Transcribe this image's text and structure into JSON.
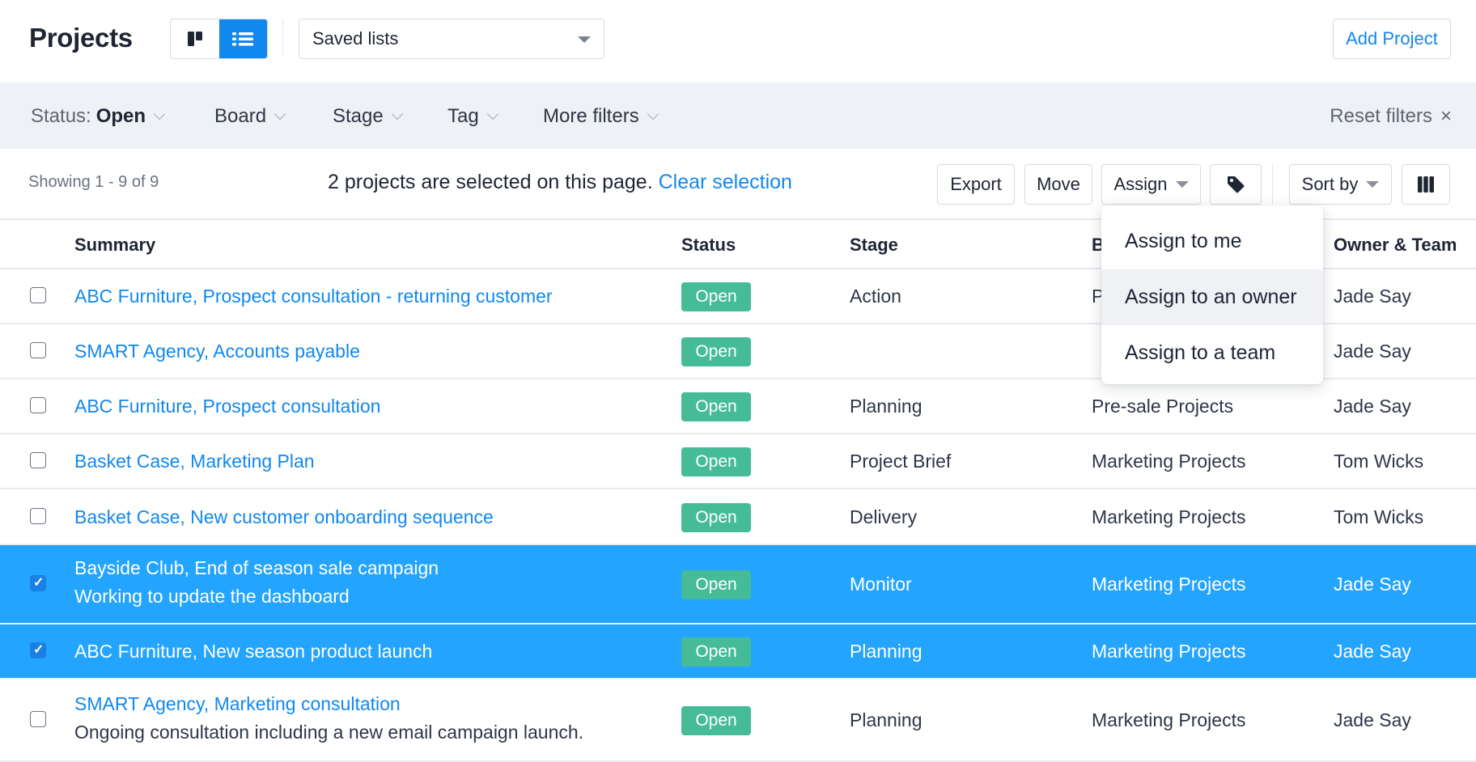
{
  "header": {
    "title": "Projects",
    "view_toggle": [
      {
        "name": "board-view",
        "icon": "kanban-icon",
        "active": false
      },
      {
        "name": "list-view",
        "icon": "list-icon",
        "active": true
      }
    ],
    "saved_lists": {
      "label": "Saved lists",
      "icon": "caret-down-icon"
    },
    "add_project_label": "Add Project"
  },
  "filters": {
    "status": {
      "label": "Status:",
      "value": "Open"
    },
    "items": [
      "Board",
      "Stage",
      "Tag",
      "More filters"
    ],
    "reset_label": "Reset filters",
    "reset_icon": "×"
  },
  "toolbar": {
    "showing": "Showing 1 - 9 of 9",
    "selection_message": "2 projects are selected on this page.",
    "clear_selection": "Clear selection",
    "buttons": {
      "export": "Export",
      "move": "Move",
      "assign": "Assign",
      "tag_icon": "tag-icon",
      "sort_by": "Sort by",
      "columns_icon": "columns-icon"
    }
  },
  "assign_menu": {
    "items": [
      "Assign to me",
      "Assign to an owner",
      "Assign to a team"
    ],
    "hovered_index": 1
  },
  "table": {
    "columns": [
      "Summary",
      "Status",
      "Stage",
      "Board",
      "Owner & Team"
    ],
    "header_board_visible": "B",
    "rows": [
      {
        "title": "ABC Furniture, Prospect consultation - returning customer",
        "subtitle": "",
        "status": "Open",
        "stage": "Action",
        "board": "Pre-sale Projects",
        "owner": "Jade Say",
        "selected": false
      },
      {
        "title": "SMART Agency, Accounts payable",
        "subtitle": "",
        "status": "Open",
        "stage": "",
        "board": "",
        "owner": "Jade Say",
        "selected": false
      },
      {
        "title": "ABC Furniture, Prospect consultation",
        "subtitle": "",
        "status": "Open",
        "stage": "Planning",
        "board": "Pre-sale Projects",
        "owner": "Jade Say",
        "selected": false
      },
      {
        "title": "Basket Case, Marketing Plan",
        "subtitle": "",
        "status": "Open",
        "stage": "Project Brief",
        "board": "Marketing Projects",
        "owner": "Tom Wicks",
        "selected": false
      },
      {
        "title": "Basket Case, New customer onboarding sequence",
        "subtitle": "",
        "status": "Open",
        "stage": "Delivery",
        "board": "Marketing Projects",
        "owner": "Tom Wicks",
        "selected": false
      },
      {
        "title": "Bayside Club, End of season sale campaign",
        "subtitle": "Working to update the dashboard",
        "status": "Open",
        "stage": "Monitor",
        "board": "Marketing Projects",
        "owner": "Jade Say",
        "selected": true
      },
      {
        "title": "ABC Furniture, New season product launch",
        "subtitle": "",
        "status": "Open",
        "stage": "Planning",
        "board": "Marketing Projects",
        "owner": "Jade Say",
        "selected": true
      },
      {
        "title": "SMART Agency, Marketing consultation",
        "subtitle": "Ongoing consultation including a new email campaign launch.",
        "status": "Open",
        "stage": "Planning",
        "board": "Marketing Projects",
        "owner": "Jade Say",
        "selected": false
      }
    ]
  },
  "colors": {
    "accent": "#1188ee",
    "selected_row": "#22a4ff",
    "status_open": "#45bc97",
    "filter_bar_bg": "#eef1f5"
  }
}
